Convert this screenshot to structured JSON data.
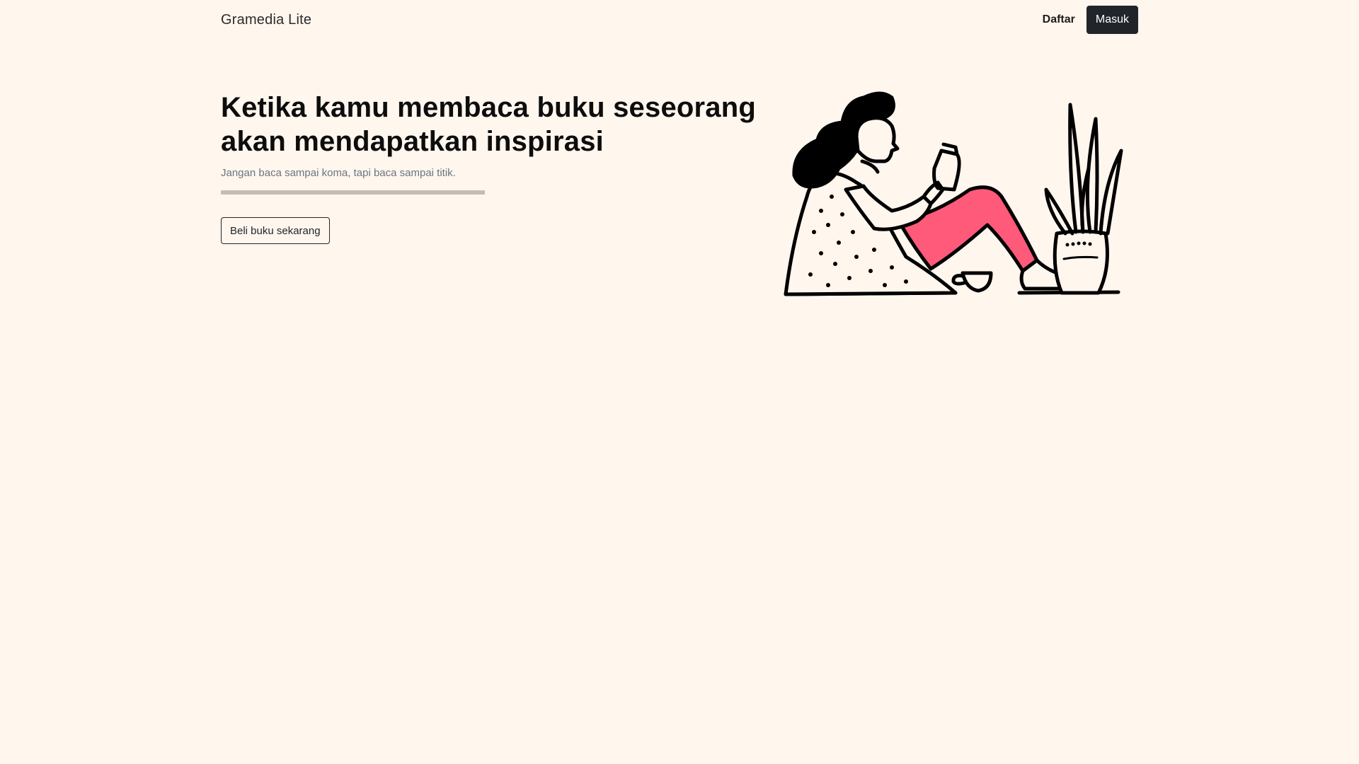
{
  "navbar": {
    "brand": "Gramedia Lite",
    "register_label": "Daftar",
    "login_label": "Masuk"
  },
  "hero": {
    "title_line1": "Ketika kamu membaca buku seseorang",
    "title_line2": "akan mendapatkan inspirasi",
    "subtitle": "Jangan baca sampai koma, tapi baca sampai titik.",
    "cta_label": "Beli buku sekarang"
  },
  "illustration": {
    "name": "woman-reading-illustration"
  },
  "colors": {
    "background": "#fff6ee",
    "dark_button": "#212529",
    "divider": "#c6bdb2",
    "pants": "#ff5a79",
    "ink": "#000000"
  }
}
